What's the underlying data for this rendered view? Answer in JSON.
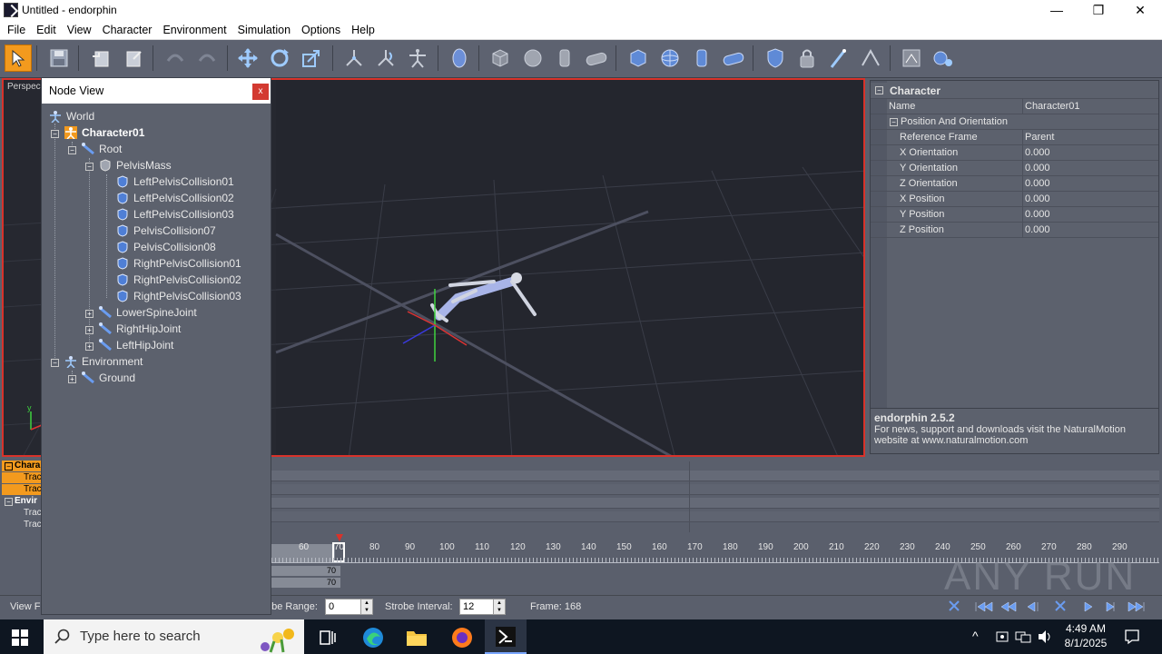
{
  "window": {
    "title": "Untitled - endorphin"
  },
  "menu": [
    "File",
    "Edit",
    "View",
    "Character",
    "Environment",
    "Simulation",
    "Options",
    "Help"
  ],
  "viewport": {
    "label": "Perspec"
  },
  "node_view": {
    "title": "Node View",
    "close": "x",
    "items": [
      {
        "label": "World"
      },
      {
        "label": "Character01"
      },
      {
        "label": "Root"
      },
      {
        "label": "PelvisMass"
      },
      {
        "label": "LeftPelvisCollision01"
      },
      {
        "label": "LeftPelvisCollision02"
      },
      {
        "label": "LeftPelvisCollision03"
      },
      {
        "label": "PelvisCollision07"
      },
      {
        "label": "PelvisCollision08"
      },
      {
        "label": "RightPelvisCollision01"
      },
      {
        "label": "RightPelvisCollision02"
      },
      {
        "label": "RightPelvisCollision03"
      },
      {
        "label": "LowerSpineJoint"
      },
      {
        "label": "RightHipJoint"
      },
      {
        "label": "LeftHipJoint"
      },
      {
        "label": "Environment"
      },
      {
        "label": "Ground"
      }
    ]
  },
  "properties": {
    "section": "Character",
    "rows": [
      {
        "key": "Name",
        "value": "Character01"
      },
      {
        "key": "Position And Orientation",
        "value": ""
      },
      {
        "key": "Reference Frame",
        "value": "Parent"
      },
      {
        "key": "X Orientation",
        "value": "0.000"
      },
      {
        "key": "Y Orientation",
        "value": "0.000"
      },
      {
        "key": "Z Orientation",
        "value": "0.000"
      },
      {
        "key": "X Position",
        "value": "0.000"
      },
      {
        "key": "Y Position",
        "value": "0.000"
      },
      {
        "key": "Z Position",
        "value": "0.000"
      }
    ],
    "footer_title": "endorphin 2.5.2",
    "footer_text": "For news, support and downloads visit the NaturalMotion website at www.naturalmotion.com"
  },
  "tracks": {
    "labels": [
      "Chara",
      "Trac",
      "Trac",
      "Envir",
      "Trac",
      "Trac"
    ]
  },
  "ruler": {
    "ticks": [
      "60",
      "70",
      "80",
      "90",
      "100",
      "110",
      "120",
      "130",
      "140",
      "150",
      "160",
      "170",
      "180",
      "190",
      "200",
      "210",
      "220",
      "230",
      "240",
      "250",
      "260",
      "270",
      "280",
      "290"
    ],
    "marker_values": [
      "70",
      "70"
    ]
  },
  "controls": {
    "view_label": "View Fr",
    "strobe_range_label": "obe Range:",
    "strobe_range_value": "0",
    "strobe_interval_label": "Strobe Interval:",
    "strobe_interval_value": "12",
    "frame_label": "Frame: 168"
  },
  "watermark": "ANY RUN",
  "taskbar": {
    "search_placeholder": "Type here to search",
    "time": "4:49 AM",
    "date": "8/1/2025"
  },
  "colors": {
    "accent": "#f39a1e",
    "viewport_border": "#d8322a",
    "panel": "#5c616d"
  }
}
